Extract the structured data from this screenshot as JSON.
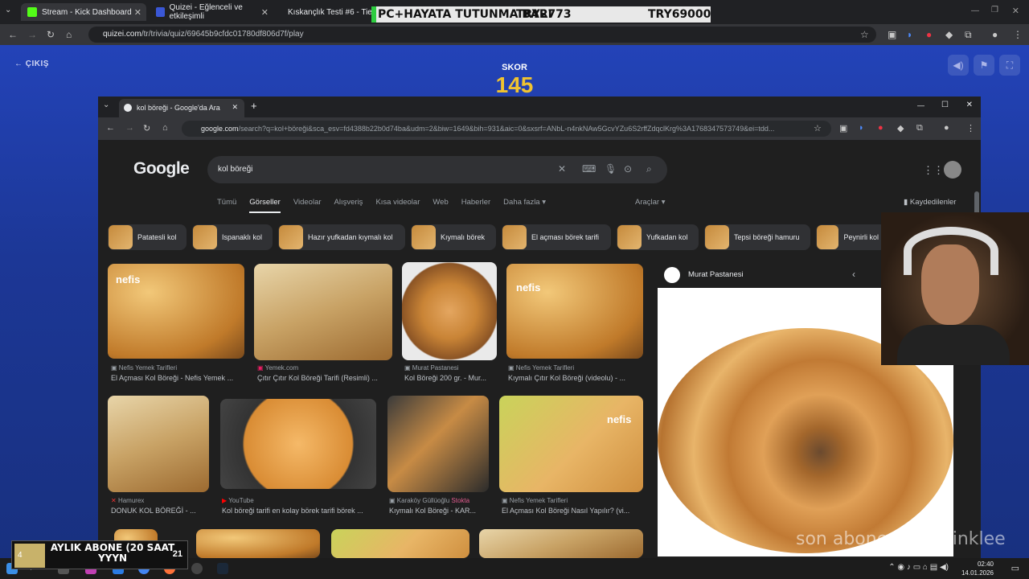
{
  "outer_browser": {
    "tabs": [
      {
        "label": "Stream - Kick Dashboard",
        "color": "#53fc18"
      },
      {
        "label": "Quizei - Eğlenceli ve etkileşimli",
        "color": "#3a57d6"
      },
      {
        "label": "Kıskançlık Testi #6 - Tier List",
        "color": "#ffffff"
      }
    ],
    "url_host": "quizei.com",
    "url_path": "/tr/trivia/quiz/69645b9cfdc01780df806d7f/play"
  },
  "overlay": {
    "title": "PC+HAYATA TUTUNMA BARI",
    "current": "TRY2773",
    "goal": "TRY69000"
  },
  "quiz": {
    "exit_label": "ÇIKIŞ",
    "score_label": "SKOR",
    "score_value": "145"
  },
  "inner_browser": {
    "tab_label": "kol böreği - Google'da Ara",
    "url_host": "google.com",
    "url_path": "/search?q=kol+böreği&sca_esv=fd4388b22b0d74ba&udm=2&biw=1649&bih=931&aic=0&sxsrf=ANbL-n4nkNAw5GcvYZu6S2rffZdqclKrg%3A1768347573749&ei=tdd..."
  },
  "google": {
    "logo": "Google",
    "query": "kol böreği",
    "tabs": [
      "Tümü",
      "Görseller",
      "Videolar",
      "Alışveriş",
      "Kısa videolar",
      "Web",
      "Haberler",
      "Daha fazla ▾"
    ],
    "tools": "Araçlar ▾",
    "saved": "Kaydedilenler",
    "chips": [
      "Patatesli kol",
      "Ispanaklı kol",
      "Hazır yufkadan kıymalı kol",
      "Kıymalı börek",
      "El açması börek tarifi",
      "Yufkadan kol",
      "Tepsi böreği hamuru",
      "Peynirli kol"
    ],
    "results_row1": [
      {
        "source": "Nefis Yemek Tarifleri",
        "title": "El Açması Kol Böreği - Nefis Yemek ..."
      },
      {
        "source": "Yemek.com",
        "title": "Çıtır Çıtır Kol Böreği Tarifi (Resimli) ..."
      },
      {
        "source": "Murat Pastanesi",
        "title": "Kol Böreği 200 gr. - Mur..."
      },
      {
        "source": "Nefis Yemek Tarifleri",
        "title": "Kıymalı Çıtır Kol Böreği (videolu) - ..."
      }
    ],
    "results_row2": [
      {
        "source": "Hamurex",
        "title": "DONUK KOL BÖREĞİ - ..."
      },
      {
        "source": "YouTube",
        "title": "Kol böreği tarifi en kolay börek tarifi börek ..."
      },
      {
        "source": "Karaköy Güllüoğlu",
        "source_extra": "Stokta",
        "title": "Kıymalı Kol Böreği - KAR..."
      },
      {
        "source": "Nefis Yemek Tarifleri",
        "title": "El Açması Kol Böreği Nasıl Yapılır? (vi..."
      }
    ],
    "watermark": "nefis",
    "panel_source": "Murat Pastanesi"
  },
  "stream_overlay": {
    "sub_count": "4",
    "sub_text": "AYLIK ABONE (20 SAAT YYYN",
    "sub_goal": "21",
    "last_sub": "son abone: Perywinklee"
  },
  "taskbar": {
    "time": "02:40",
    "date": "14.01.2026"
  }
}
